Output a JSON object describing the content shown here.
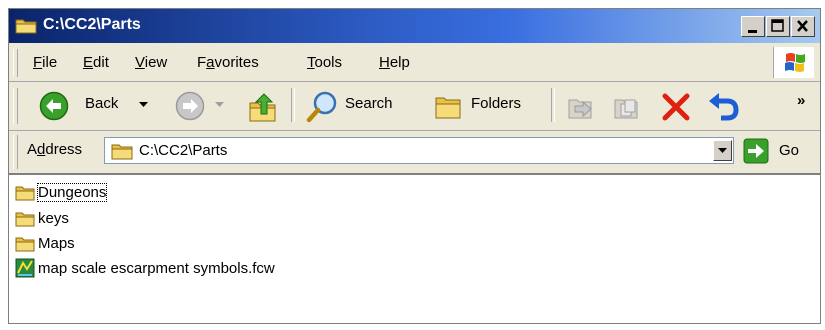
{
  "window": {
    "title": "C:\\CC2\\Parts"
  },
  "menu": [
    {
      "u": "F",
      "rest": "ile"
    },
    {
      "u": "E",
      "rest": "dit"
    },
    {
      "u": "V",
      "rest": "iew"
    },
    {
      "pre": "F",
      "u": "a",
      "rest": "vorites"
    },
    {
      "u": "T",
      "rest": "ools"
    },
    {
      "u": "H",
      "rest": "elp"
    }
  ],
  "toolbar": {
    "back_label": "Back",
    "search_label": "Search",
    "folders_label": "Folders",
    "chevron": "»"
  },
  "address": {
    "label_pre": "A",
    "label_u": "d",
    "label_rest": "dress",
    "value": "C:\\CC2\\Parts",
    "go_label": "Go"
  },
  "files": [
    {
      "name": "Dungeons",
      "type": "folder"
    },
    {
      "name": "keys",
      "type": "folder"
    },
    {
      "name": "Maps",
      "type": "folder"
    },
    {
      "name": "map scale escarpment symbols.fcw",
      "type": "fcw-file"
    }
  ],
  "colors": {
    "titlebar_start": "#0a246a",
    "titlebar_end": "#a6caf0",
    "chrome": "#ece9d8",
    "back_green": "#3aa02c",
    "delete_red": "#e02010"
  }
}
